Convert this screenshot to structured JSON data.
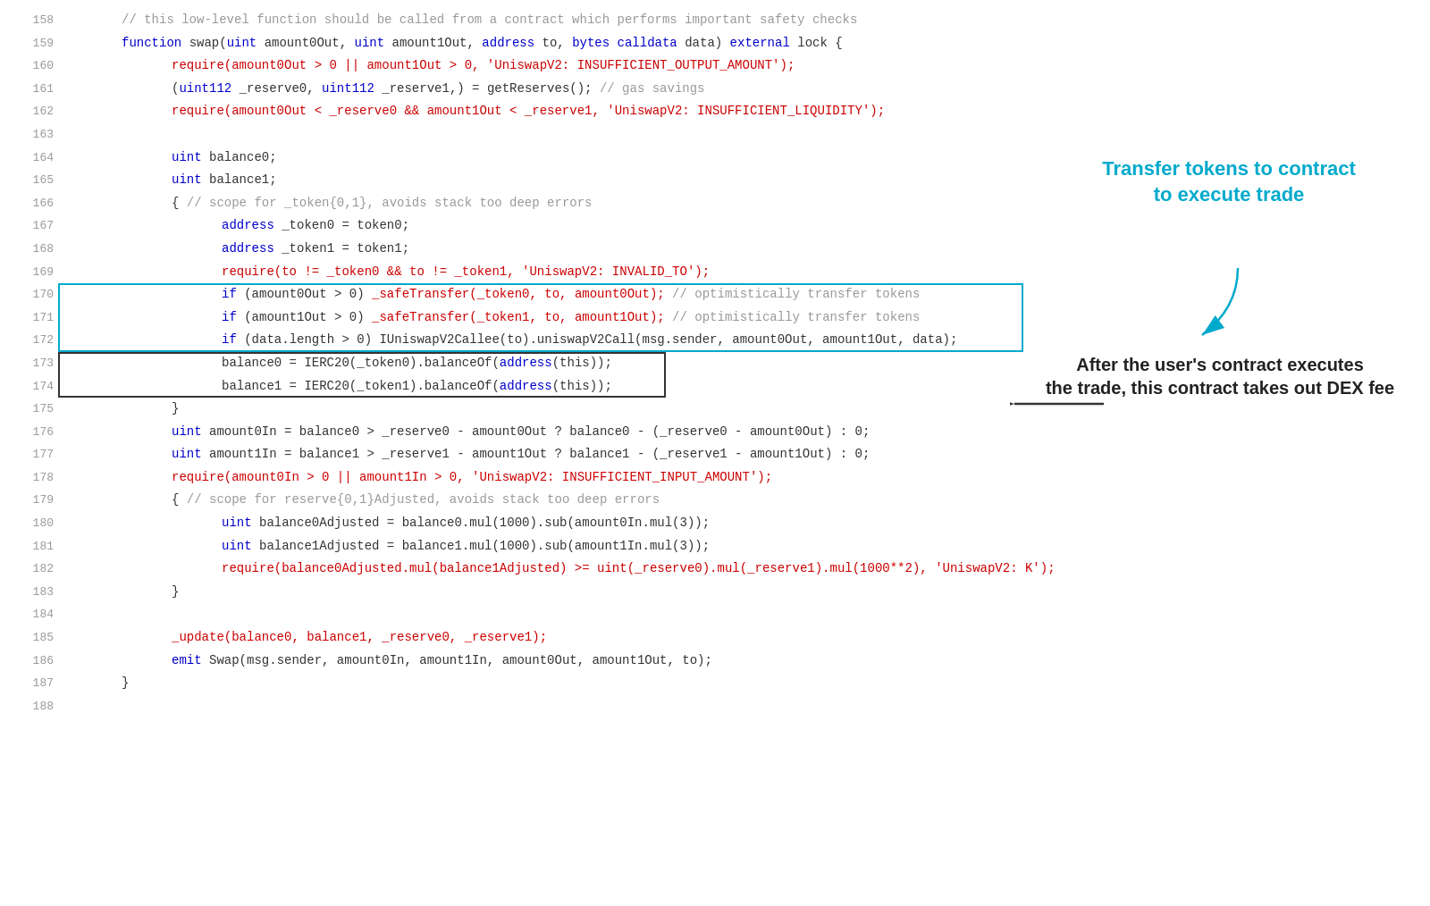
{
  "lines": [
    {
      "num": "158",
      "indent": 2,
      "content": [
        {
          "t": "comment",
          "v": "// this low-level function should be called from a contract which performs important safety checks"
        }
      ]
    },
    {
      "num": "159",
      "indent": 2,
      "content": [
        {
          "t": "kw",
          "v": "function "
        },
        {
          "t": "ident",
          "v": "swap("
        },
        {
          "t": "kw",
          "v": "uint "
        },
        {
          "t": "ident",
          "v": "amount0Out, "
        },
        {
          "t": "kw",
          "v": "uint "
        },
        {
          "t": "ident",
          "v": "amount1Out, "
        },
        {
          "t": "kw",
          "v": "address "
        },
        {
          "t": "ident",
          "v": "to, "
        },
        {
          "t": "kw",
          "v": "bytes calldata "
        },
        {
          "t": "ident",
          "v": "data) "
        },
        {
          "t": "kw",
          "v": "external "
        },
        {
          "t": "ident",
          "v": "lock {"
        }
      ]
    },
    {
      "num": "160",
      "indent": 4,
      "content": [
        {
          "t": "fn",
          "v": "require(amount0Out > 0 || amount1Out > 0, 'UniswapV2: INSUFFICIENT_OUTPUT_AMOUNT');"
        }
      ]
    },
    {
      "num": "161",
      "indent": 4,
      "content": [
        {
          "t": "ident",
          "v": "("
        },
        {
          "t": "kw",
          "v": "uint112 "
        },
        {
          "t": "ident",
          "v": "_reserve0, "
        },
        {
          "t": "kw",
          "v": "uint112 "
        },
        {
          "t": "ident",
          "v": "_reserve1,) = getReserves(); "
        },
        {
          "t": "comment",
          "v": "// gas savings"
        }
      ]
    },
    {
      "num": "162",
      "indent": 4,
      "content": [
        {
          "t": "fn",
          "v": "require(amount0Out < _reserve0 && amount1Out < _reserve1, 'UniswapV2: INSUFFICIENT_LIQUIDITY');"
        }
      ]
    },
    {
      "num": "163",
      "indent": 0,
      "content": []
    },
    {
      "num": "164",
      "indent": 4,
      "content": [
        {
          "t": "kw",
          "v": "uint "
        },
        {
          "t": "ident",
          "v": "balance0;"
        }
      ]
    },
    {
      "num": "165",
      "indent": 4,
      "content": [
        {
          "t": "kw",
          "v": "uint "
        },
        {
          "t": "ident",
          "v": "balance1;"
        }
      ]
    },
    {
      "num": "166",
      "indent": 4,
      "content": [
        {
          "t": "ident",
          "v": "{ "
        },
        {
          "t": "comment",
          "v": "// scope for _token{0,1}, avoids stack too deep errors"
        }
      ]
    },
    {
      "num": "167",
      "indent": 6,
      "content": [
        {
          "t": "kw",
          "v": "address "
        },
        {
          "t": "ident",
          "v": "_token0 = token0;"
        }
      ]
    },
    {
      "num": "168",
      "indent": 6,
      "content": [
        {
          "t": "kw",
          "v": "address "
        },
        {
          "t": "ident",
          "v": "_token1 = token1;"
        }
      ]
    },
    {
      "num": "169",
      "indent": 6,
      "content": [
        {
          "t": "fn",
          "v": "require(to != _token0 && to != _token1, 'UniswapV2: INVALID_TO');"
        }
      ]
    },
    {
      "num": "170",
      "indent": 6,
      "content": [
        {
          "t": "kw",
          "v": "if "
        },
        {
          "t": "ident",
          "v": "(amount0Out > 0) "
        },
        {
          "t": "fn",
          "v": "_safeTransfer(_token0, to, amount0Out);"
        },
        {
          "t": "comment",
          "v": " // optimistically transfer tokens"
        }
      ]
    },
    {
      "num": "171",
      "indent": 6,
      "content": [
        {
          "t": "kw",
          "v": "if "
        },
        {
          "t": "ident",
          "v": "(amount1Out > 0) "
        },
        {
          "t": "fn",
          "v": "_safeTransfer(_token1, to, amount1Out);"
        },
        {
          "t": "comment",
          "v": " // optimistically transfer tokens"
        }
      ]
    },
    {
      "num": "172",
      "indent": 6,
      "content": [
        {
          "t": "kw",
          "v": "if "
        },
        {
          "t": "ident",
          "v": "(data.length > 0) IUniswapV2Callee(to).uniswapV2Call(msg.sender, amount0Out, amount1Out, data);"
        }
      ]
    },
    {
      "num": "173",
      "indent": 6,
      "content": [
        {
          "t": "ident",
          "v": "balance0 = IERC20(_token0).balanceOf("
        },
        {
          "t": "kw",
          "v": "address"
        },
        {
          "t": "ident",
          "v": "(this));"
        }
      ]
    },
    {
      "num": "174",
      "indent": 6,
      "content": [
        {
          "t": "ident",
          "v": "balance1 = IERC20(_token1).balanceOf("
        },
        {
          "t": "kw",
          "v": "address"
        },
        {
          "t": "ident",
          "v": "(this));"
        }
      ]
    },
    {
      "num": "175",
      "indent": 4,
      "content": [
        {
          "t": "ident",
          "v": "}"
        }
      ]
    },
    {
      "num": "176",
      "indent": 4,
      "content": [
        {
          "t": "kw",
          "v": "uint "
        },
        {
          "t": "ident",
          "v": "amount0In = balance0 > _reserve0 - amount0Out ? balance0 - (_reserve0 - amount0Out) : 0;"
        }
      ]
    },
    {
      "num": "177",
      "indent": 4,
      "content": [
        {
          "t": "kw",
          "v": "uint "
        },
        {
          "t": "ident",
          "v": "amount1In = balance1 > _reserve1 - amount1Out ? balance1 - (_reserve1 - amount1Out) : 0;"
        }
      ]
    },
    {
      "num": "178",
      "indent": 4,
      "content": [
        {
          "t": "fn",
          "v": "require(amount0In > 0 || amount1In > 0, 'UniswapV2: INSUFFICIENT_INPUT_AMOUNT');"
        }
      ]
    },
    {
      "num": "179",
      "indent": 4,
      "content": [
        {
          "t": "ident",
          "v": "{ "
        },
        {
          "t": "comment",
          "v": "// scope for reserve{0,1}Adjusted, avoids stack too deep errors"
        }
      ]
    },
    {
      "num": "180",
      "indent": 6,
      "content": [
        {
          "t": "kw",
          "v": "uint "
        },
        {
          "t": "ident",
          "v": "balance0Adjusted = balance0.mul(1000).sub(amount0In.mul(3));"
        }
      ]
    },
    {
      "num": "181",
      "indent": 6,
      "content": [
        {
          "t": "kw",
          "v": "uint "
        },
        {
          "t": "ident",
          "v": "balance1Adjusted = balance1.mul(1000).sub(amount1In.mul(3));"
        }
      ]
    },
    {
      "num": "182",
      "indent": 6,
      "content": [
        {
          "t": "fn",
          "v": "require(balance0Adjusted.mul(balance1Adjusted) >= uint(_reserve0).mul(_reserve1).mul(1000**2), 'UniswapV2: K');"
        }
      ]
    },
    {
      "num": "183",
      "indent": 4,
      "content": [
        {
          "t": "ident",
          "v": "}"
        }
      ]
    },
    {
      "num": "184",
      "indent": 0,
      "content": []
    },
    {
      "num": "185",
      "indent": 4,
      "content": [
        {
          "t": "fn",
          "v": "_update(balance0, balance1, _reserve0, _reserve1);"
        }
      ]
    },
    {
      "num": "186",
      "indent": 4,
      "content": [
        {
          "t": "kw",
          "v": "emit "
        },
        {
          "t": "ident",
          "v": "Swap(msg.sender, amount0In, amount1In, amount0Out, amount1Out, to);"
        }
      ]
    },
    {
      "num": "187",
      "indent": 2,
      "content": [
        {
          "t": "ident",
          "v": "}"
        }
      ]
    },
    {
      "num": "188",
      "indent": 0,
      "content": []
    }
  ],
  "annotations": {
    "cyan_title": "Transfer tokens to contract",
    "cyan_subtitle": "to execute trade",
    "dark_title": "After the user's contract executes",
    "dark_subtitle": "the trade, this contract takes out DEX fee"
  }
}
